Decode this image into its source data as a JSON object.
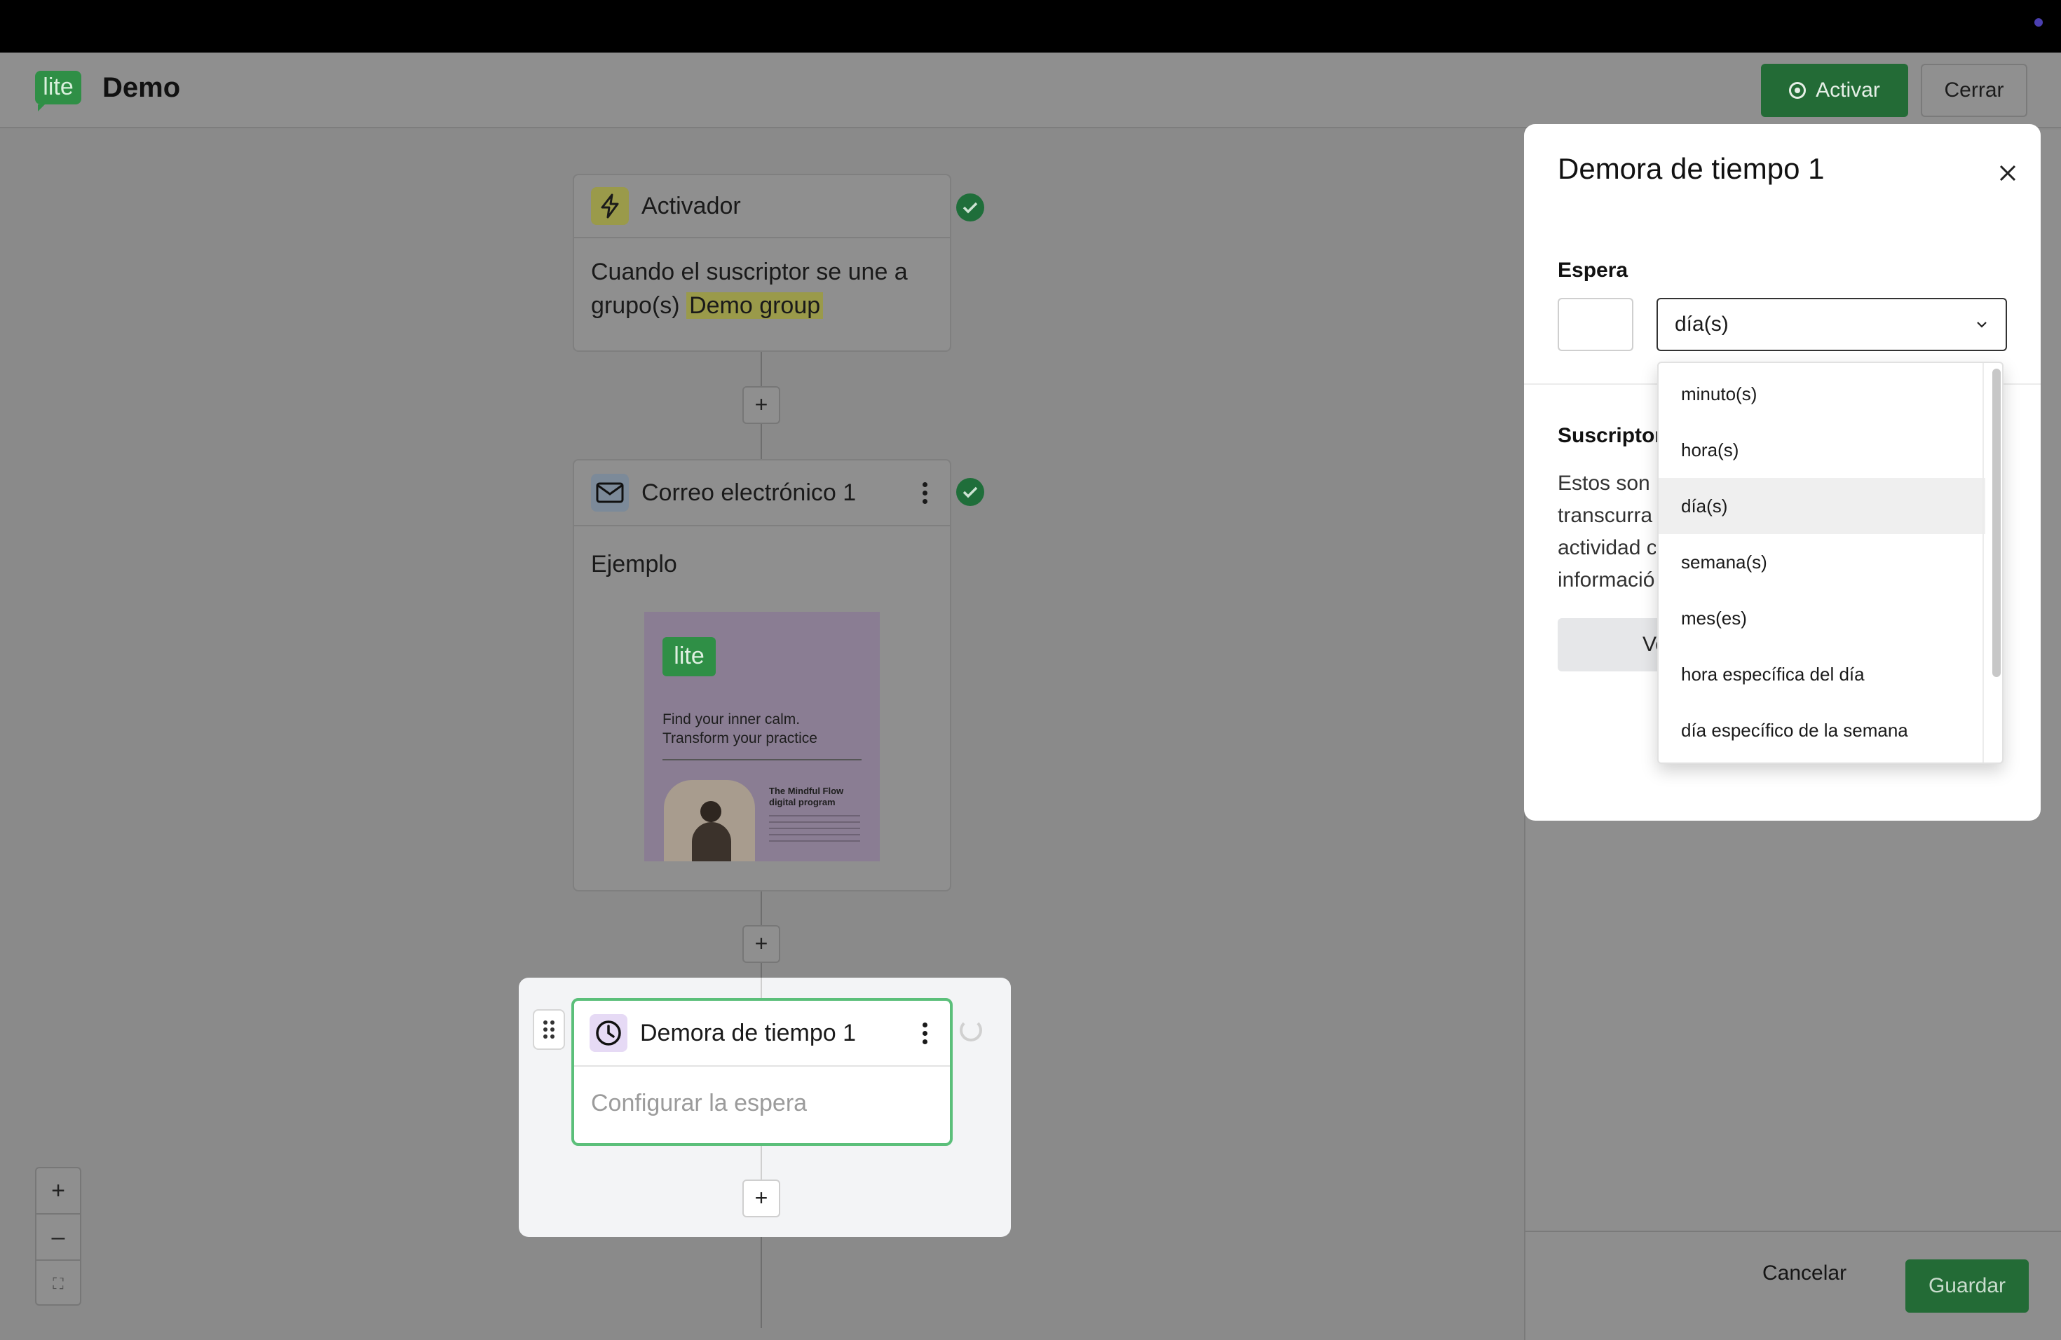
{
  "header": {
    "logo_text": "lite",
    "title": "Demo",
    "activate_label": "Activar",
    "close_label": "Cerrar"
  },
  "workflow": {
    "trigger": {
      "title": "Activador",
      "body_prefix": "Cuando el suscriptor se une a grupo(s)",
      "group_tag": "Demo group"
    },
    "email": {
      "title": "Correo electrónico 1",
      "body": "Ejemplo",
      "preview": {
        "logo": "lite",
        "headline": "Find your inner calm. Transform your practice",
        "subtitle": "The Mindful Flow digital program"
      }
    },
    "delay": {
      "title": "Demora de tiempo 1",
      "placeholder": "Configurar la espera"
    },
    "add_label": "+"
  },
  "zoom": {
    "in": "+",
    "out": "–",
    "fit": "⛶"
  },
  "panel": {
    "title": "Demora de tiempo 1",
    "wait_label": "Espera",
    "wait_value": "",
    "unit_selected": "día(s)",
    "subscribers_label": "Suscriptor",
    "subscribers_text": [
      "Estos son",
      "transcurra",
      "actividad c",
      "informació"
    ],
    "view_button": "Ve",
    "units": [
      "minuto(s)",
      "hora(s)",
      "día(s)",
      "semana(s)",
      "mes(es)",
      "hora específica del día",
      "día específico de la semana"
    ],
    "cancel_label": "Cancelar",
    "save_label": "Guardar"
  },
  "colors": {
    "brand_green": "#2f8f46",
    "highlight_border": "#5bbf7a",
    "check_green": "#1f6e3a"
  }
}
